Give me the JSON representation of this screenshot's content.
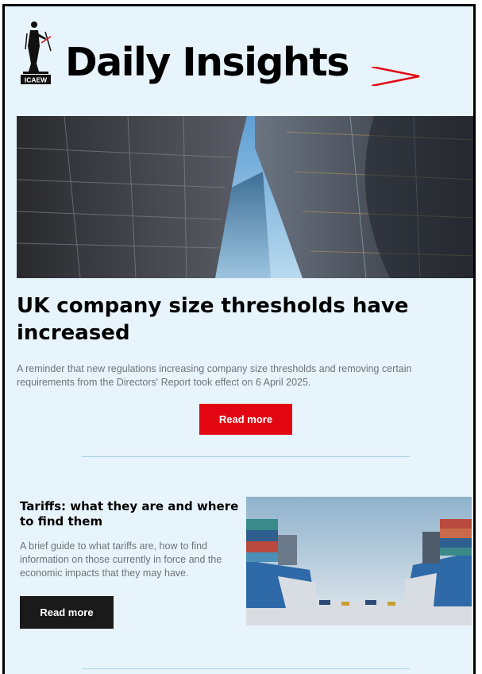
{
  "header": {
    "logo_text": "ICAEW",
    "title": "Daily Insights"
  },
  "hero": {
    "headline": "UK company size thresholds have increased",
    "summary": "A reminder that new regulations increasing company size thresholds and removing certain requirements from the Directors' Report took effect on 6 April 2025.",
    "cta_label": "Read more"
  },
  "article2": {
    "headline": "Tariffs: what they are and where to find them",
    "summary": "A brief guide to what tariffs are, how to find information on those currently in force and the economic impacts that they may have.",
    "cta_label": "Read more"
  },
  "colors": {
    "background": "#e8f4fb",
    "accent_red": "#e20613",
    "dark_button": "#1a1a1a",
    "divider": "#a9d4ec",
    "body_text": "#6d7378"
  },
  "icons": [
    "icaew-justice-figure-logo",
    "chevron-right-icon"
  ]
}
